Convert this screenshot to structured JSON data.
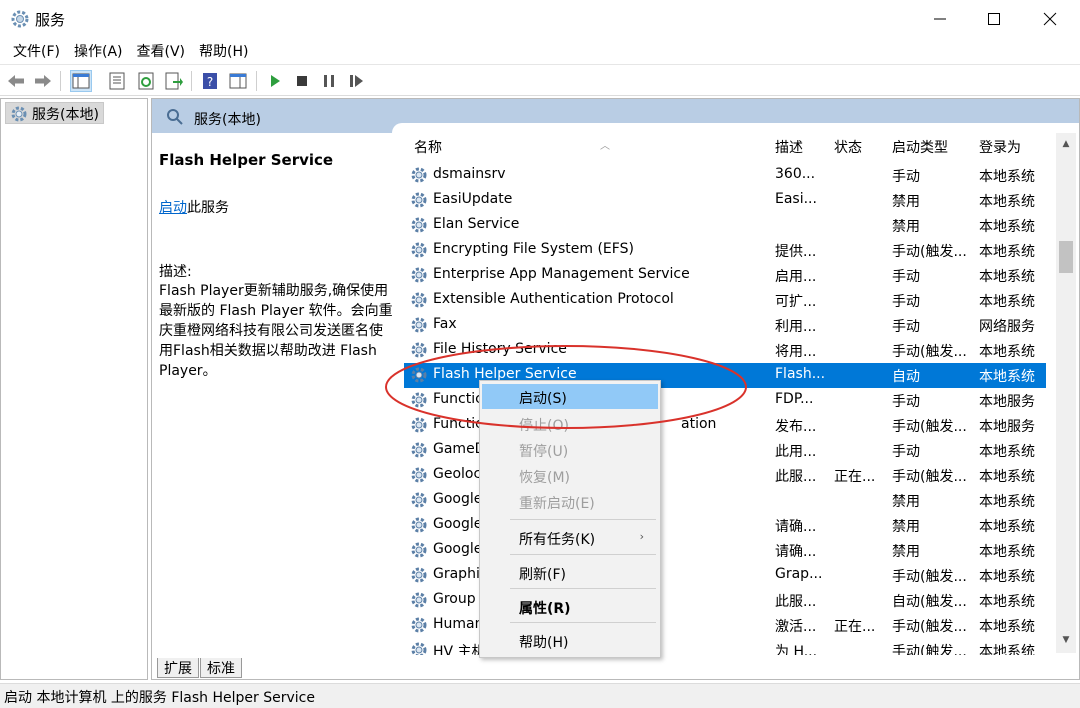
{
  "window": {
    "title": "服务",
    "minimize_icon": "minimize-icon",
    "maximize_icon": "maximize-icon",
    "close_icon": "close-icon"
  },
  "menu": [
    "文件(F)",
    "操作(A)",
    "查看(V)",
    "帮助(H)"
  ],
  "toolbar": [
    "back-arrow-icon",
    "forward-arrow-icon",
    "console-tree-icon",
    "properties-icon",
    "refresh-icon",
    "export-list-icon",
    "help-icon",
    "show-pane-icon",
    "start-service-icon",
    "stop-service-icon",
    "pause-service-icon",
    "resume-service-icon"
  ],
  "tree": {
    "root": "服务(本地)"
  },
  "panel": {
    "header": "服务(本地)",
    "service_name": "Flash Helper Service",
    "action_link": "启动",
    "action_suffix": "此服务",
    "desc_label": "描述:",
    "desc_text": "Flash Player更新辅助服务,确保使用最新版的 Flash Player 软件。会向重庆重橙网络科技有限公司发送匿名使用Flash相关数据以帮助改进 Flash Player。"
  },
  "columns": {
    "name": "名称",
    "desc": "描述",
    "status": "状态",
    "startup": "启动类型",
    "logon": "登录为"
  },
  "rows": [
    {
      "name": "dsmainsrv",
      "desc": "360...",
      "status": "",
      "startup": "手动",
      "logon": "本地系统"
    },
    {
      "name": "EasiUpdate",
      "desc": "Easi...",
      "status": "",
      "startup": "禁用",
      "logon": "本地系统"
    },
    {
      "name": "Elan Service",
      "desc": "",
      "status": "",
      "startup": "禁用",
      "logon": "本地系统"
    },
    {
      "name": "Encrypting File System (EFS)",
      "desc": "提供...",
      "status": "",
      "startup": "手动(触发...",
      "logon": "本地系统"
    },
    {
      "name": "Enterprise App Management Service",
      "desc": "启用...",
      "status": "",
      "startup": "手动",
      "logon": "本地系统"
    },
    {
      "name": "Extensible Authentication Protocol",
      "desc": "可扩...",
      "status": "",
      "startup": "手动",
      "logon": "本地系统"
    },
    {
      "name": "Fax",
      "desc": "利用...",
      "status": "",
      "startup": "手动",
      "logon": "网络服务"
    },
    {
      "name": "File History Service",
      "desc": "将用...",
      "status": "",
      "startup": "手动(触发...",
      "logon": "本地系统"
    },
    {
      "name": "Flash Helper Service",
      "desc": "Flash...",
      "status": "",
      "startup": "自动",
      "logon": "本地系统"
    },
    {
      "name": "Functic",
      "desc": "FDP...",
      "status": "",
      "startup": "手动",
      "logon": "本地服务"
    },
    {
      "name": "Functic",
      "desc": "发布...",
      "status": "",
      "startup": "手动(触发...",
      "logon": "本地服务"
    },
    {
      "name": "GameD",
      "desc": "此用...",
      "status": "",
      "startup": "手动",
      "logon": "本地系统"
    },
    {
      "name": "Geoloc",
      "desc": "此服...",
      "status": "正在...",
      "startup": "手动(触发...",
      "logon": "本地系统"
    },
    {
      "name": "Google",
      "desc": "",
      "status": "",
      "startup": "禁用",
      "logon": "本地系统"
    },
    {
      "name": "Google",
      "desc": "请确...",
      "status": "",
      "startup": "禁用",
      "logon": "本地系统"
    },
    {
      "name": "Google",
      "desc": "请确...",
      "status": "",
      "startup": "禁用",
      "logon": "本地系统"
    },
    {
      "name": "Graphic",
      "desc": "Grap...",
      "status": "",
      "startup": "手动(触发...",
      "logon": "本地系统"
    },
    {
      "name": "Group",
      "desc": "此服...",
      "status": "",
      "startup": "自动(触发...",
      "logon": "本地系统"
    },
    {
      "name": "Human",
      "desc": "激活...",
      "status": "正在...",
      "startup": "手动(触发...",
      "logon": "本地系统"
    },
    {
      "name": "HV 主机",
      "desc": "为 H...",
      "status": "",
      "startup": "手动(触发...",
      "logon": "本地系统"
    }
  ],
  "functic_suffix": "ation",
  "tabs": [
    "扩展",
    "标准"
  ],
  "status_bar": "启动 本地计算机 上的服务 Flash Helper Service",
  "context_menu": {
    "start": "启动(S)",
    "stop": "停止(O)",
    "pause": "暂停(U)",
    "resume": "恢复(M)",
    "restart": "重新启动(E)",
    "all_tasks": "所有任务(K)",
    "refresh": "刷新(F)",
    "properties": "属性(R)",
    "help": "帮助(H)"
  },
  "colors": {
    "selection": "#0078d7",
    "header": "#b9cde4",
    "menu_highlight": "#91c9f7",
    "annotation": "#d9322b",
    "link": "#0066cc"
  }
}
